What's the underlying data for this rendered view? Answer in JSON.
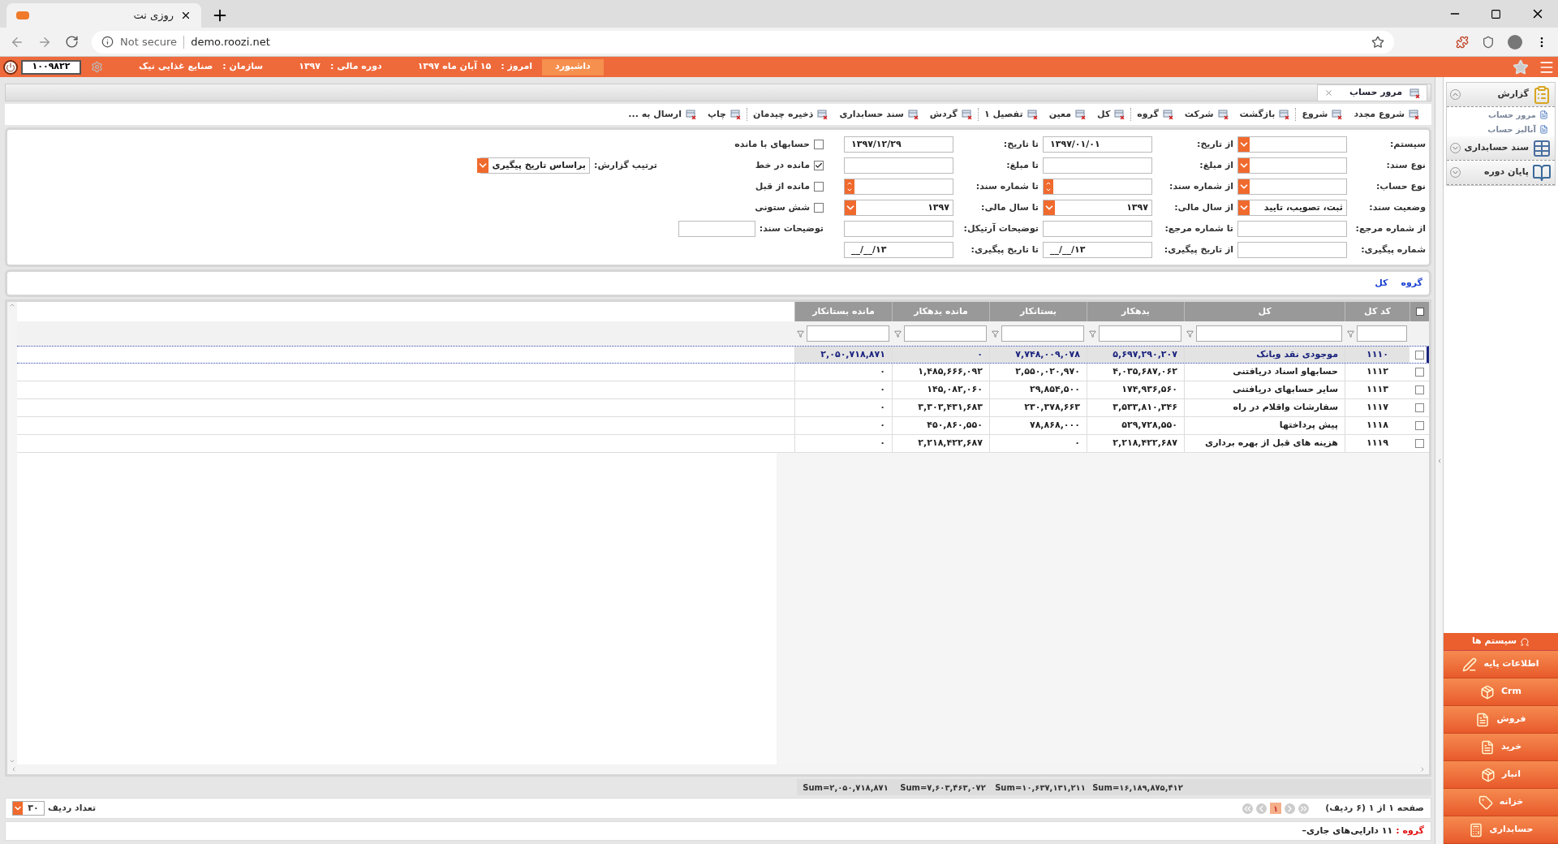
{
  "browser": {
    "tab_title": "روزی نت",
    "security": "Not secure",
    "url": "demo.roozi.net"
  },
  "header": {
    "dashboard": "داشبورد",
    "today_label": "امروز :",
    "today": "۱۵ آبان ماه ۱۳۹۷",
    "period_label": "دوره مالی :",
    "period": "۱۳۹۷",
    "org_label": "سازمان :",
    "org": "صنایع غذایی نیک",
    "user_code": "۱۰۰۹۸۲۲"
  },
  "page_tab": "مرور حساب",
  "toolbar": [
    "شروع مجدد",
    "شروع",
    "بازگشت",
    "شرکت",
    "گروه",
    "کل",
    "معین",
    "تفصیل ۱",
    "گردش",
    "سند حسابداری",
    "ذخیره چیدمان",
    "چاپ",
    "ارسال به ..."
  ],
  "filters": [
    [
      {
        "kind": "select",
        "label": "سیستم:"
      },
      {
        "kind": "text",
        "label": "از تاریخ:",
        "value": "۱۳۹۷/۰۱/۰۱"
      },
      {
        "kind": "text",
        "label": "تا تاریخ:",
        "value": "۱۳۹۷/۱۲/۲۹"
      },
      {
        "kind": "checkbox",
        "label": "حسابهای با مانده",
        "checked": false
      }
    ],
    [
      {
        "kind": "select",
        "label": "نوع سند:"
      },
      {
        "kind": "text",
        "label": "از مبلغ:"
      },
      {
        "kind": "text",
        "label": "تا مبلغ:"
      },
      {
        "kind": "checkbox",
        "label": "مانده در خط",
        "checked": true
      }
    ],
    [
      {
        "kind": "select",
        "label": "نوع حساب:"
      },
      {
        "kind": "spinner",
        "label": "از شماره سند:"
      },
      {
        "kind": "spinner",
        "label": "تا شماره سند:"
      },
      {
        "kind": "checkbox",
        "label": "مانده از قبل",
        "checked": false
      }
    ],
    [
      {
        "kind": "select",
        "label": "وضعیت سند:",
        "value": "ثبت، تصویب، تایید"
      },
      {
        "kind": "select",
        "label": "از سال مالی:",
        "value": "۱۳۹۷"
      },
      {
        "kind": "select",
        "label": "تا سال مالی:",
        "value": "۱۳۹۷"
      },
      {
        "kind": "checkbox",
        "label": "شش ستونی",
        "checked": false
      }
    ],
    [
      {
        "kind": "text",
        "label": "از شماره مرجع:"
      },
      {
        "kind": "text",
        "label": "تا شماره مرجع:"
      },
      {
        "kind": "text",
        "label": "توضیحات آرتیکل:"
      },
      {
        "kind": "short",
        "label": "توضیحات سند:"
      }
    ],
    [
      {
        "kind": "text",
        "label": "شماره پیگیری:"
      },
      {
        "kind": "text",
        "label": "از تاریخ پیگیری:",
        "value": "__/__/۱۳"
      },
      {
        "kind": "text",
        "label": "تا تاریخ پیگیری:",
        "value": "__/__/۱۳"
      }
    ]
  ],
  "report_order": {
    "label": "ترتیب گزارش:",
    "value": "براساس تاریخ پیگیری"
  },
  "breadcrumb": [
    "گروه",
    "کل"
  ],
  "table": {
    "select_all_checked": false,
    "columns": [
      "کد کل",
      "کل",
      "بدهکار",
      "بستانکار",
      "مانده بدهکار",
      "مانده بستانکار"
    ],
    "rows": [
      {
        "cells": [
          "۱۱۱۰",
          "موجودی نقد وبانک",
          "۵,۶۹۷,۲۹۰,۲۰۷",
          "۷,۷۴۸,۰۰۹,۰۷۸",
          "۰",
          "۲,۰۵۰,۷۱۸,۸۷۱"
        ],
        "selected": true,
        "checked": false
      },
      {
        "cells": [
          "۱۱۱۲",
          "حسابهاو اسناد دریافتنی",
          "۴,۰۳۵,۶۸۷,۰۶۲",
          "۲,۵۵۰,۰۲۰,۹۷۰",
          "۱,۴۸۵,۶۶۶,۰۹۲",
          "۰"
        ],
        "selected": false,
        "checked": false
      },
      {
        "cells": [
          "۱۱۱۳",
          "سایر حسابهای دریافتنی",
          "۱۷۴,۹۳۶,۵۶۰",
          "۲۹,۸۵۴,۵۰۰",
          "۱۴۵,۰۸۲,۰۶۰",
          "۰"
        ],
        "selected": false,
        "checked": false
      },
      {
        "cells": [
          "۱۱۱۷",
          "سفارشات واقلام در راه",
          "۳,۵۳۳,۸۱۰,۳۴۶",
          "۲۳۰,۳۷۸,۶۶۳",
          "۳,۳۰۳,۴۳۱,۶۸۳",
          "۰"
        ],
        "selected": false,
        "checked": false
      },
      {
        "cells": [
          "۱۱۱۸",
          "پیش پرداختها",
          "۵۲۹,۷۲۸,۵۵۰",
          "۷۸,۸۶۸,۰۰۰",
          "۴۵۰,۸۶۰,۵۵۰",
          "۰"
        ],
        "selected": false,
        "checked": false
      },
      {
        "cells": [
          "۱۱۱۹",
          "هزینه های قبل از بهره برداری",
          "۲,۲۱۸,۴۲۲,۶۸۷",
          "۰",
          "۲,۲۱۸,۴۲۲,۶۸۷",
          "۰"
        ],
        "selected": false,
        "checked": false
      }
    ],
    "sums": [
      "Sum=۱۶,۱۸۹,۸۷۵,۴۱۲",
      "Sum=۱۰,۶۳۷,۱۳۱,۲۱۱",
      "Sum=۷,۶۰۳,۴۶۳,۰۷۲",
      "Sum=۲,۰۵۰,۷۱۸,۸۷۱"
    ]
  },
  "pager": {
    "info": "صفحه ۱ از ۱ (۶ ردیف)",
    "page": "۱",
    "page_size_label": "تعداد ردیف",
    "page_size": "۳۰"
  },
  "status": {
    "label": "گروه :",
    "value": "۱۱ دارایی‌های جاری–"
  },
  "sidebar": {
    "sections": [
      {
        "title": "گزارش",
        "expanded": true,
        "items": [
          "مرور حساب",
          "آنالیز حساب"
        ]
      },
      {
        "title": "سند حسابداری",
        "expanded": false
      },
      {
        "title": "پایان دوره",
        "expanded": false
      }
    ],
    "systems_title": "سیستم ها",
    "systems": [
      "اطلاعات پایه",
      "Crm",
      "فروش",
      "خرید",
      "انبار",
      "خزانه",
      "حسابداری"
    ]
  }
}
